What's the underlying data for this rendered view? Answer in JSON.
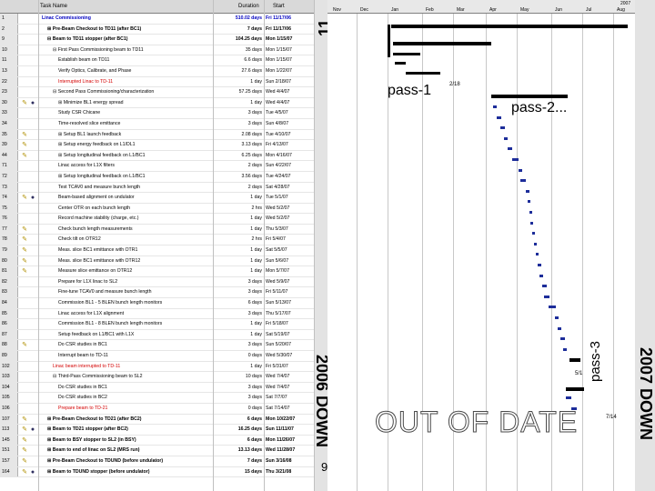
{
  "table": {
    "header": {
      "id": "",
      "icons": "",
      "task_name": "Task Name",
      "duration": "Duration",
      "start": "Start"
    },
    "rows": [
      {
        "id": "1",
        "icons": "",
        "indent": 0,
        "name": "Linac Commissioning",
        "duration": "510.02 days",
        "start": "Fri 11/17/06",
        "style": "bold blue"
      },
      {
        "id": "2",
        "icons": "",
        "indent": 1,
        "name": "⊞ Pre-Beam Checkout to TD11 (after BC1)",
        "duration": "7 days",
        "start": "Fri 11/17/06",
        "style": "bold"
      },
      {
        "id": "9",
        "icons": "",
        "indent": 1,
        "name": "⊟ Beam to TD11 stopper (after BC1)",
        "duration": "104.25 days",
        "start": "Mon 1/15/07",
        "style": "bold"
      },
      {
        "id": "10",
        "icons": "",
        "indent": 2,
        "name": "⊟ First Pass Commissioning beam to TD11",
        "duration": "35 days",
        "start": "Mon 1/15/07",
        "style": ""
      },
      {
        "id": "11",
        "icons": "",
        "indent": 3,
        "name": "Establish beam on TD11",
        "duration": "6.6 days",
        "start": "Mon 1/15/07",
        "style": ""
      },
      {
        "id": "13",
        "icons": "",
        "indent": 3,
        "name": "Verify Optics, Calibrate, and Phase",
        "duration": "27.6 days",
        "start": "Mon 1/22/07",
        "style": ""
      },
      {
        "id": "22",
        "icons": "",
        "indent": 3,
        "name": "Interrupted Linac to TD-11",
        "duration": "1 day",
        "start": "Sun 2/18/07",
        "style": "red"
      },
      {
        "id": "23",
        "icons": "",
        "indent": 2,
        "name": "⊟ Second Pass Commissioning/characterization",
        "duration": "57.25 days",
        "start": "Wed 4/4/07",
        "style": ""
      },
      {
        "id": "30",
        "icons": "ab",
        "indent": 3,
        "name": "⊞ Minimize BL1 energy spread",
        "duration": "1 day",
        "start": "Wed 4/4/07",
        "style": ""
      },
      {
        "id": "33",
        "icons": "",
        "indent": 3,
        "name": "Study CSR Chicane",
        "duration": "3 days",
        "start": "Tue 4/5/07",
        "style": ""
      },
      {
        "id": "34",
        "icons": "",
        "indent": 3,
        "name": "Time-resolved slice emittance",
        "duration": "3 days",
        "start": "Sun 4/8/07",
        "style": ""
      },
      {
        "id": "35",
        "icons": "a",
        "indent": 3,
        "name": "⊞ Setup BL1 launch feedback",
        "duration": "2.08 days",
        "start": "Tue 4/10/07",
        "style": ""
      },
      {
        "id": "39",
        "icons": "a",
        "indent": 3,
        "name": "⊞ Setup energy feedback on L1/DL1",
        "duration": "3.13 days",
        "start": "Fri 4/13/07",
        "style": ""
      },
      {
        "id": "44",
        "icons": "a",
        "indent": 3,
        "name": "⊞ Setup longitudinal feedback on L1/BC1",
        "duration": "6.25 days",
        "start": "Mon 4/16/07",
        "style": ""
      },
      {
        "id": "71",
        "icons": "",
        "indent": 3,
        "name": "Linac access for L1X filters",
        "duration": "2 days",
        "start": "Sun 4/22/07",
        "style": ""
      },
      {
        "id": "72",
        "icons": "",
        "indent": 3,
        "name": "⊞ Setup longitudinal feedback on L1/BC1",
        "duration": "3.56 days",
        "start": "Tue 4/24/07",
        "style": ""
      },
      {
        "id": "73",
        "icons": "",
        "indent": 3,
        "name": "Test TCAV0 and measure bunch length",
        "duration": "2 days",
        "start": "Sat 4/28/07",
        "style": ""
      },
      {
        "id": "74",
        "icons": "ab",
        "indent": 3,
        "name": "Beam-based alignment on undulator",
        "duration": "1 day",
        "start": "Tue 5/1/07",
        "style": ""
      },
      {
        "id": "75",
        "icons": "",
        "indent": 3,
        "name": "Center OTR on each bunch length",
        "duration": "2 hrs",
        "start": "Wed 5/2/07",
        "style": ""
      },
      {
        "id": "76",
        "icons": "",
        "indent": 3,
        "name": "Record machine stability (charge, etc.)",
        "duration": "1 day",
        "start": "Wed 5/2/07",
        "style": ""
      },
      {
        "id": "77",
        "icons": "a",
        "indent": 3,
        "name": "Check bunch length measurements",
        "duration": "1 day",
        "start": "Thu 5/3/07",
        "style": ""
      },
      {
        "id": "78",
        "icons": "a",
        "indent": 3,
        "name": "Check tilt on OTR12",
        "duration": "2 hrs",
        "start": "Fri 5/4/07",
        "style": ""
      },
      {
        "id": "79",
        "icons": "a",
        "indent": 3,
        "name": "Meas. slice BC1 emittance with OTR1",
        "duration": "1 day",
        "start": "Sat 5/5/07",
        "style": ""
      },
      {
        "id": "80",
        "icons": "a",
        "indent": 3,
        "name": "Meas. slice BC1 emittance with OTR12",
        "duration": "1 day",
        "start": "Sun 5/6/07",
        "style": ""
      },
      {
        "id": "81",
        "icons": "a",
        "indent": 3,
        "name": "Measure slice emittance on OTR12",
        "duration": "1 day",
        "start": "Mon 5/7/07",
        "style": ""
      },
      {
        "id": "82",
        "icons": "",
        "indent": 3,
        "name": "Prepare for L1X linac to SL2",
        "duration": "3 days",
        "start": "Wed 5/9/07",
        "style": ""
      },
      {
        "id": "83",
        "icons": "",
        "indent": 3,
        "name": "Fine-tune TCAV0 and measure bunch length",
        "duration": "3 days",
        "start": "Fri 5/11/07",
        "style": ""
      },
      {
        "id": "84",
        "icons": "",
        "indent": 3,
        "name": "Commission BL1 - 5 BLEN bunch length monitors",
        "duration": "6 days",
        "start": "Sun 5/13/07",
        "style": ""
      },
      {
        "id": "85",
        "icons": "",
        "indent": 3,
        "name": "Linac access for L1X alignment",
        "duration": "3 days",
        "start": "Thu 5/17/07",
        "style": ""
      },
      {
        "id": "86",
        "icons": "",
        "indent": 3,
        "name": "Commission BL1 - 8 BLEN bunch length monitors",
        "duration": "1 day",
        "start": "Fri 5/18/07",
        "style": ""
      },
      {
        "id": "87",
        "icons": "",
        "indent": 3,
        "name": "Setup feedback on L1/BC1 with L1X",
        "duration": "1 day",
        "start": "Sat 5/19/07",
        "style": ""
      },
      {
        "id": "88",
        "icons": "a",
        "indent": 3,
        "name": "Do CSR studies in BC1",
        "duration": "3 days",
        "start": "Sun 5/20/07",
        "style": ""
      },
      {
        "id": "89",
        "icons": "",
        "indent": 3,
        "name": "Interrupt beam to TD-11",
        "duration": "0 days",
        "start": "Wed 5/30/07",
        "style": ""
      },
      {
        "id": "102",
        "icons": "",
        "indent": 2,
        "name": "Linac beam interrupted to TD-11",
        "duration": "1 day",
        "start": "Fri 5/31/07",
        "style": "red"
      },
      {
        "id": "103",
        "icons": "",
        "indent": 2,
        "name": "⊟ Third-Pass Commissioning beam to SL2",
        "duration": "10 days",
        "start": "Wed 7/4/07",
        "style": ""
      },
      {
        "id": "104",
        "icons": "",
        "indent": 3,
        "name": "Do CSR studies in BC1",
        "duration": "3 days",
        "start": "Wed 7/4/07",
        "style": ""
      },
      {
        "id": "105",
        "icons": "",
        "indent": 3,
        "name": "Do CSR studies in BC2",
        "duration": "3 days",
        "start": "Sat 7/7/07",
        "style": ""
      },
      {
        "id": "106",
        "icons": "",
        "indent": 3,
        "name": "Prepare beam to TD-21",
        "duration": "0 days",
        "start": "Sat 7/14/07",
        "style": "red"
      },
      {
        "id": "107",
        "icons": "a",
        "indent": 1,
        "name": "⊞ Pre-Beam Checkout to TD21 (after BC2)",
        "duration": "6 days",
        "start": "Mon 10/22/07",
        "style": "bold"
      },
      {
        "id": "113",
        "icons": "ab",
        "indent": 1,
        "name": "⊞ Beam to TD21 stopper (after BC2)",
        "duration": "16.25 days",
        "start": "Sun 11/11/07",
        "style": "bold"
      },
      {
        "id": "145",
        "icons": "a",
        "indent": 1,
        "name": "⊞ Beam to BSY stopper to SL2 (in BSY)",
        "duration": "6 days",
        "start": "Mon 11/26/07",
        "style": "bold"
      },
      {
        "id": "151",
        "icons": "a",
        "indent": 1,
        "name": "⊞ Beam to end of linac on SL2 (MRS run)",
        "duration": "13.13 days",
        "start": "Wed 11/28/07",
        "style": "bold"
      },
      {
        "id": "157",
        "icons": "a",
        "indent": 1,
        "name": "⊞ Pre-Beam Checkout to TDUND (before undulator)",
        "duration": "7 days",
        "start": "Sun 3/16/08",
        "style": "bold"
      },
      {
        "id": "164",
        "icons": "ab",
        "indent": 1,
        "name": "⊞ Beam to TDUND stopper (before undulator)",
        "duration": "15 days",
        "start": "Thu 3/21/08",
        "style": "bold"
      }
    ]
  },
  "timescale": {
    "year_label": "2007",
    "months": [
      "Nov",
      "Dec",
      "Jan",
      "Feb",
      "Mar",
      "Apr",
      "May",
      "Jun",
      "Jul",
      "Aug"
    ]
  },
  "annotations": {
    "pass1": "pass-1",
    "pass1_date": "2/18",
    "pass2": "pass-2...",
    "pass3": "pass-3",
    "marker_5_1": "5/1",
    "marker_7_14": "7/14",
    "top_band_number": "11",
    "down_2006": "2006 DOWN",
    "down_2007": "2007 DOWN",
    "out_of_date": "OUT OF DATE",
    "page_number": "9"
  },
  "colors": {
    "header_bg": "#d9d9d9",
    "band_bg": "#e3e3e3",
    "gantt_task_bar": "#1d2d9a",
    "summary_bar": "#000000",
    "interrupt_text": "#d40000"
  }
}
